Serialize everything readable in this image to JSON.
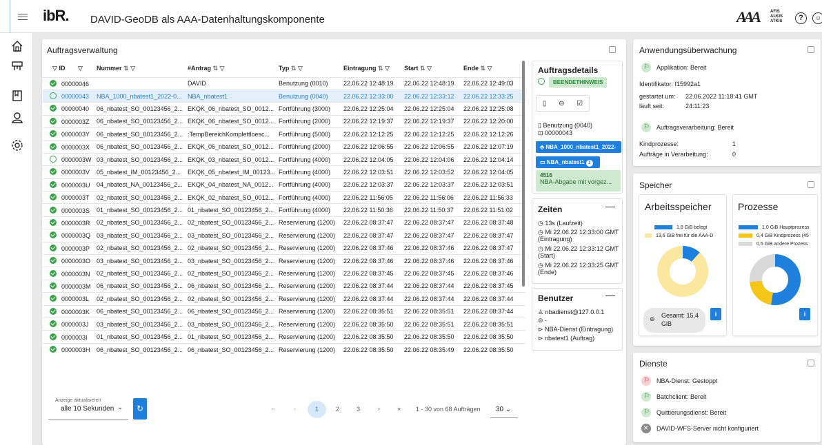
{
  "header": {
    "logo_text": "ibR.",
    "title": "DAVID-GeoDB als AAA-Datenhaltungskomponente",
    "aaa_logo": "AAA",
    "aaa_sub": [
      "AFIS",
      "ALKIS",
      "ATKIS"
    ],
    "help_icon": "?",
    "user_icon": "user-circle-icon"
  },
  "sidebar": {
    "items": [
      "home-icon",
      "stamp-icon",
      "book-icon",
      "user-icon",
      "settings-icon"
    ]
  },
  "orders": {
    "title": "Auftragsverwaltung",
    "columns": [
      "ID",
      "Nummer",
      "#Antrag",
      "Typ",
      "Eintragung",
      "Start",
      "Ende"
    ],
    "rows": [
      {
        "status": "ok",
        "id": "00000046",
        "nummer": "",
        "antrag": "DAVID",
        "typ": "Benutzung (0010)",
        "eintragung": "22.06.22 12:48:19",
        "start": "22.06.22 12:48:19",
        "ende": "22.06.22 12:49:03"
      },
      {
        "status": "msg",
        "id": "00000043",
        "nummer": "NBA_1000_nbatest1_2022-0...",
        "antrag": "NBA_nbatest1",
        "typ": "Benutzung (0040)",
        "eintragung": "22.06.22 12:33:00",
        "start": "22.06.22 12:33:12",
        "ende": "22.06.22 12:33:25",
        "selected": true
      },
      {
        "status": "ok",
        "id": "00000040",
        "nummer": "06_nbatest_SO_00123456_2...",
        "antrag": "EKQK_06_nbatest_SO_0012...",
        "typ": "Fortführung (3000)",
        "eintragung": "22.06.22 12:25:04",
        "start": "22.06.22 12:25:04",
        "ende": "22.06.22 12:25:08"
      },
      {
        "status": "ok",
        "id": "0000003Z",
        "nummer": "06_nbatest_SO_00123456_2...",
        "antrag": "EKQK_06_nbatest_SO_0012...",
        "typ": "Fortführung (2000)",
        "eintragung": "22.06.22 12:19:37",
        "start": "22.06.22 12:19:37",
        "ende": "22.06.22 12:20:00"
      },
      {
        "status": "ok",
        "id": "0000003Y",
        "nummer": "06_nbatest_SO_00123456_2...",
        "antrag": ":TempBereichKomplettloesc...",
        "typ": "Fortführung (5000)",
        "eintragung": "22.06.22 12:12:25",
        "start": "22.06.22 12:12:25",
        "ende": "22.06.22 12:12:26"
      },
      {
        "status": "ok",
        "id": "0000003X",
        "nummer": "06_nbatest_SO_00123456_2...",
        "antrag": "EKQK_06_nbatest_SO_0012...",
        "typ": "Fortführung (2000)",
        "eintragung": "22.06.22 12:06:55",
        "start": "22.06.22 12:06:55",
        "ende": "22.06.22 12:07:19"
      },
      {
        "status": "msg",
        "id": "0000003W",
        "nummer": "03_nbatest_SO_00123456_2...",
        "antrag": "EKQK_03_nbatest_SO_0012...",
        "typ": "Fortführung (4000)",
        "eintragung": "22.06.22 12:04:05",
        "start": "22.06.22 12:04:06",
        "ende": "22.06.22 12:04:14"
      },
      {
        "status": "ok",
        "id": "0000003V",
        "nummer": "05_nbatest_IM_00123456_2...",
        "antrag": "EKQK_05_nbatest_IM_00123...",
        "typ": "Fortführung (4000)",
        "eintragung": "22.06.22 12:03:51",
        "start": "22.06.22 12:03:52",
        "ende": "22.06.22 12:04:05"
      },
      {
        "status": "ok",
        "id": "0000003U",
        "nummer": "04_nbatest_NA_00123456_2...",
        "antrag": "EKQK_04_nbatest_NA_0012...",
        "typ": "Fortführung (4000)",
        "eintragung": "22.06.22 12:03:37",
        "start": "22.06.22 12:03:37",
        "ende": "22.06.22 12:03:51"
      },
      {
        "status": "ok",
        "id": "0000003T",
        "nummer": "02_nbatest_SO_00123456_2...",
        "antrag": "EKQK_02_nbatest_SO_0012...",
        "typ": "Fortführung (4000)",
        "eintragung": "22.06.22 11:56:05",
        "start": "22.06.22 11:56:06",
        "ende": "22.06.22 11:56:33"
      },
      {
        "status": "ok",
        "id": "0000003S",
        "nummer": "01_nbatest_SO_00123456_2...",
        "antrag": "01_nbatest_SO_00123456_2...",
        "typ": "Fortführung (4000)",
        "eintragung": "22.06.22 11:50:36",
        "start": "22.06.22 11:50:37",
        "ende": "22.06.22 11:51:02"
      },
      {
        "status": "ok",
        "id": "0000003R",
        "nummer": "02_nbatest_SO_00123456_2...",
        "antrag": "02_nbatest_SO_00123456_2...",
        "typ": "Reservierung (1200)",
        "eintragung": "22.06.22 08:37:47",
        "start": "22.06.22 08:37:47",
        "ende": "22.06.22 08:37:48"
      },
      {
        "status": "ok",
        "id": "0000003Q",
        "nummer": "03_nbatest_SO_00123456_2...",
        "antrag": "03_nbatest_SO_00123456_2...",
        "typ": "Reservierung (1200)",
        "eintragung": "22.06.22 08:37:47",
        "start": "22.06.22 08:37:47",
        "ende": "22.06.22 08:37:47"
      },
      {
        "status": "ok",
        "id": "0000003P",
        "nummer": "02_nbatest_SO_00123456_2...",
        "antrag": "02_nbatest_SO_00123456_2...",
        "typ": "Reservierung (1200)",
        "eintragung": "22.06.22 08:37:46",
        "start": "22.06.22 08:37:46",
        "ende": "22.06.22 08:37:47"
      },
      {
        "status": "ok",
        "id": "0000003O",
        "nummer": "03_nbatest_SO_00123456_2...",
        "antrag": "03_nbatest_SO_00123456_2...",
        "typ": "Reservierung (1200)",
        "eintragung": "22.06.22 08:37:46",
        "start": "22.06.22 08:37:46",
        "ende": "22.06.22 08:37:46"
      },
      {
        "status": "ok",
        "id": "0000003N",
        "nummer": "02_nbatest_SO_00123456_2...",
        "antrag": "02_nbatest_SO_00123456_2...",
        "typ": "Reservierung (1200)",
        "eintragung": "22.06.22 08:37:45",
        "start": "22.06.22 08:37:45",
        "ende": "22.06.22 08:37:46"
      },
      {
        "status": "ok",
        "id": "0000003M",
        "nummer": "06_nbatest_SO_00123456_2...",
        "antrag": "06_nbatest_SO_00123456_2...",
        "typ": "Reservierung (1200)",
        "eintragung": "22.06.22 08:37:44",
        "start": "22.06.22 08:37:44",
        "ende": "22.06.22 08:37:45"
      },
      {
        "status": "ok",
        "id": "0000003L",
        "nummer": "02_nbatest_SO_00123456_2...",
        "antrag": "02_nbatest_SO_00123456_2...",
        "typ": "Reservierung (1200)",
        "eintragung": "22.06.22 08:37:44",
        "start": "22.06.22 08:37:44",
        "ende": "22.06.22 08:37:44"
      },
      {
        "status": "ok",
        "id": "0000003K",
        "nummer": "06_nbatest_SO_00123456_2...",
        "antrag": "06_nbatest_SO_00123456_2...",
        "typ": "Reservierung (1200)",
        "eintragung": "22.06.22 08:35:51",
        "start": "22.06.22 08:35:51",
        "ende": "22.06.22 08:37:44"
      },
      {
        "status": "ok",
        "id": "0000003J",
        "nummer": "03_nbatest_SO_00123456_2...",
        "antrag": "03_nbatest_SO_00123456_2...",
        "typ": "Reservierung (1200)",
        "eintragung": "22.06.22 08:35:50",
        "start": "22.06.22 08:35:51",
        "ende": "22.06.22 08:35:51"
      },
      {
        "status": "ok",
        "id": "0000003I",
        "nummer": "01_nbatest_SO_00123456_2...",
        "antrag": "01_nbatest_SO_00123456_2...",
        "typ": "Reservierung (1200)",
        "eintragung": "22.06.22 08:35:50",
        "start": "22.06.22 08:35:50",
        "ende": "22.06.22 08:35:50"
      },
      {
        "status": "ok",
        "id": "0000003H",
        "nummer": "06_nbatest_SO_00123456_2...",
        "antrag": "06_nbatest_SO_00123456_2...",
        "typ": "Reservierung (1200)",
        "eintragung": "22.06.22 08:35:50",
        "start": "22.06.22 08:35:49",
        "ende": "22.06.22 08:35:50"
      }
    ],
    "refresh_label": "Anzeige aktualisieren",
    "refresh_value": "alle 10 Sekunden",
    "pages": [
      "1",
      "2",
      "3"
    ],
    "range_text": "1 - 30 von 68 Aufträgen",
    "page_size": "30"
  },
  "details": {
    "title": "Auftragsdetails",
    "status_chip": "BEENDETHINWEIS",
    "type": "Benutzung (0040)",
    "id": "00000043",
    "btn1": "NBA_1000_nbatest1_2022-",
    "btn2": "NBA_nbatest1",
    "btn2_badge": "1",
    "msg_code": "4516",
    "msg_text": "NBA-Abgabe mit vorgez...",
    "times_title": "Zeiten",
    "duration": "13s (Laufzeit)",
    "t1": "Mi 22.06.22 12:33:00 GMT (Eintragung)",
    "t2": "Mi 22.06.22 12:33:12 GMT (Start)",
    "t3": "Mi 22.06.22 12:33:25 GMT (Ende)",
    "users_title": "Benutzer",
    "u1": "nbadienst@127.0.0.1",
    "u2": "-",
    "u3": "NBA-Dienst (Eintragung)",
    "u4": "nbatest1 (Auftrag)"
  },
  "monitor": {
    "title": "Anwendungsüberwachung",
    "app_status": "Applikation: Bereit",
    "id_label": "Identifikator: f15992a1",
    "started_label": "gestartet um:",
    "started_value": "22.06.2022 11:18:41 GMT",
    "running_label": "läuft seit:",
    "running_value": "24:11:23",
    "proc_status": "Auftragsverarbeitung: Bereit",
    "children_label": "Kindprozesse:",
    "children_value": "1",
    "jobs_label": "Aufträge in Verarbeitung:",
    "jobs_value": "0"
  },
  "memory": {
    "title": "Speicher",
    "work_title": "Arbeitsspeicher",
    "work_legend": [
      "1,8 GiB belegt",
      "13,6 GiB frei für die AAA-D"
    ],
    "work_values": [
      1.8,
      13.6
    ],
    "work_total": "Gesamt: 15,4 GiB",
    "proc_title": "Prozesse",
    "proc_legend": [
      "1,0 GiB Hauptprozess",
      "0,4 GiB Kindprozess (45",
      "0,5 GiB andere Prozess"
    ],
    "proc_values": [
      1.0,
      0.4,
      0.5
    ],
    "info_btn": "i",
    "colors": [
      "#1e7fdc",
      "#fbe7a0",
      "#f5c518",
      "#d8d8d8"
    ]
  },
  "services": {
    "title": "Dienste",
    "items": [
      {
        "state": "err",
        "label": "NBA-Dienst: Gestoppt"
      },
      {
        "state": "ok",
        "label": "Batchclient: Bereit"
      },
      {
        "state": "ok",
        "label": "Quittierungsdienst: Bereit"
      },
      {
        "state": "off",
        "label": "DAVID-WFS-Server nicht konfiguriert"
      }
    ]
  }
}
